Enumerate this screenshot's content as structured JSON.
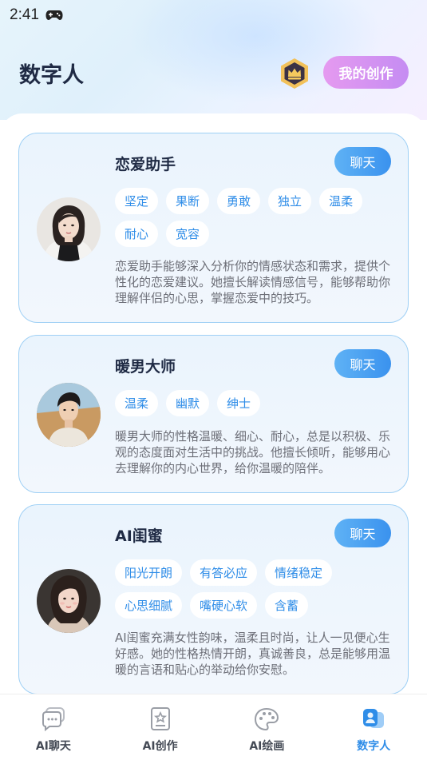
{
  "status": {
    "time": "2:41",
    "icon": "gamepad-icon"
  },
  "header": {
    "title": "数字人",
    "my_create_label": "我的创作",
    "badge_icon": "crown-badge-icon"
  },
  "cards": [
    {
      "name": "恋爱助手",
      "chat_label": "聊天",
      "tags": [
        "坚定",
        "果断",
        "勇敢",
        "独立",
        "温柔",
        "耐心",
        "宽容"
      ],
      "description": "恋爱助手能够深入分析你的情感状态和需求，提供个性化的恋爱建议。她擅长解读情感信号，能够帮助你理解伴侣的心思，掌握恋爱中的技巧。"
    },
    {
      "name": "暖男大师",
      "chat_label": "聊天",
      "tags": [
        "温柔",
        "幽默",
        "绅士"
      ],
      "description": "暖男大师的性格温暖、细心、耐心，总是以积极、乐观的态度面对生活中的挑战。他擅长倾听，能够用心去理解你的内心世界，给你温暖的陪伴。"
    },
    {
      "name": "AI闺蜜",
      "chat_label": "聊天",
      "tags": [
        "阳光开朗",
        "有答必应",
        "情绪稳定",
        "心思细腻",
        "嘴硬心软",
        "含蓄"
      ],
      "description": "AI闺蜜充满女性韵味，温柔且时尚，让人一见便心生好感。她的性格热情开朗，真诚善良，总是能够用温暖的言语和贴心的举动给你安慰。"
    }
  ],
  "tabbar": {
    "items": [
      {
        "label": "AI聊天",
        "icon": "chat-bubble-icon",
        "active": false
      },
      {
        "label": "AI创作",
        "icon": "document-star-icon",
        "active": false
      },
      {
        "label": "AI绘画",
        "icon": "palette-icon",
        "active": false
      },
      {
        "label": "数字人",
        "icon": "digital-human-icon",
        "active": true
      }
    ]
  },
  "colors": {
    "accent": "#2f8de8",
    "title": "#1f2a44",
    "create_btn": "#d993f1",
    "card_border": "#9fd0f5"
  }
}
